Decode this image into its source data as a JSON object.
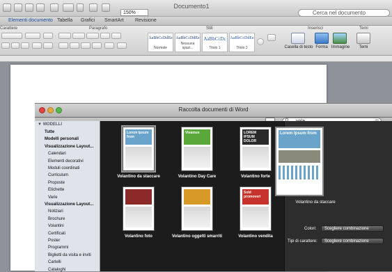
{
  "window": {
    "title": "Documento1"
  },
  "toolbar": {
    "zoom": "150%",
    "search_placeholder": "Cerca nel documento"
  },
  "ribbon_tabs": [
    "Elementi documento",
    "Tabella",
    "Grafici",
    "SmartArt",
    "Revisione"
  ],
  "ribbon_groups": {
    "font": "Carattere",
    "paragraph": "Paragrafo",
    "styles": "Stili",
    "insert": "Inserisci",
    "themes": "Temi"
  },
  "styles": [
    {
      "sample": "AaBbCcDdEe",
      "name": "Normale"
    },
    {
      "sample": "AaBbCcDdEe",
      "name": "Nessuna spazi..."
    },
    {
      "sample": "AaBbCcDc",
      "name": "Titolo 1"
    },
    {
      "sample": "AaBbCcDdEe",
      "name": "Titolo 2"
    }
  ],
  "insert_buttons": {
    "textbox": "Casella di testo",
    "shape": "Forma",
    "image": "Immagine",
    "themes": "Temi"
  },
  "dialog": {
    "title": "Raccolta documenti di Word",
    "search_value": "vola",
    "sidebar": {
      "section": "MODELLI",
      "items": [
        {
          "label": "Tutte",
          "type": "head"
        },
        {
          "label": "Modelli personali",
          "type": "head"
        },
        {
          "label": "Visualizzazione Layout...",
          "type": "head"
        },
        {
          "label": "Calendari",
          "type": "sub"
        },
        {
          "label": "Elementi decorativi",
          "type": "sub"
        },
        {
          "label": "Moduli coordinati",
          "type": "sub"
        },
        {
          "label": "Curriculum",
          "type": "sub"
        },
        {
          "label": "Proposte",
          "type": "sub"
        },
        {
          "label": "Etichette",
          "type": "sub"
        },
        {
          "label": "Varie",
          "type": "sub"
        },
        {
          "label": "Visualizzazione Layout...",
          "type": "head"
        },
        {
          "label": "Notiziari",
          "type": "sub"
        },
        {
          "label": "Brochure",
          "type": "sub"
        },
        {
          "label": "Volantini",
          "type": "sub"
        },
        {
          "label": "Certificati",
          "type": "sub"
        },
        {
          "label": "Poster",
          "type": "sub"
        },
        {
          "label": "Programmi",
          "type": "sub"
        },
        {
          "label": "Biglietti da visita e inviti",
          "type": "sub"
        },
        {
          "label": "Cartelli",
          "type": "sub"
        },
        {
          "label": "Cataloghi",
          "type": "sub"
        }
      ]
    },
    "templates": [
      {
        "label": "Volantino da staccare",
        "heading": "Lorem Ipsum from",
        "color": "#6aa3c9"
      },
      {
        "label": "Volantino Day Care",
        "heading": "Vivamus",
        "color": "#5aa83a"
      },
      {
        "label": "Volantino forte",
        "heading": "LOREM IPSUM DOLOR",
        "color": "#2a2a2a"
      },
      {
        "label": "Volantino foto",
        "heading": "",
        "color": "#8c2a2a"
      },
      {
        "label": "Volantino oggetti smarriti",
        "heading": "",
        "color": "#d79a26"
      },
      {
        "label": "Volantino vendita",
        "heading": "Sold promoveri",
        "color": "#c8322c"
      }
    ],
    "preview": {
      "heading": "Lorem Ipsum from",
      "label": "Volantino da staccare",
      "colors_label": "Colori:",
      "colors_value": "Scegliere combinazione",
      "fonts_label": "Tipi di carattere:",
      "fonts_value": "Scegliere combinazione"
    }
  }
}
